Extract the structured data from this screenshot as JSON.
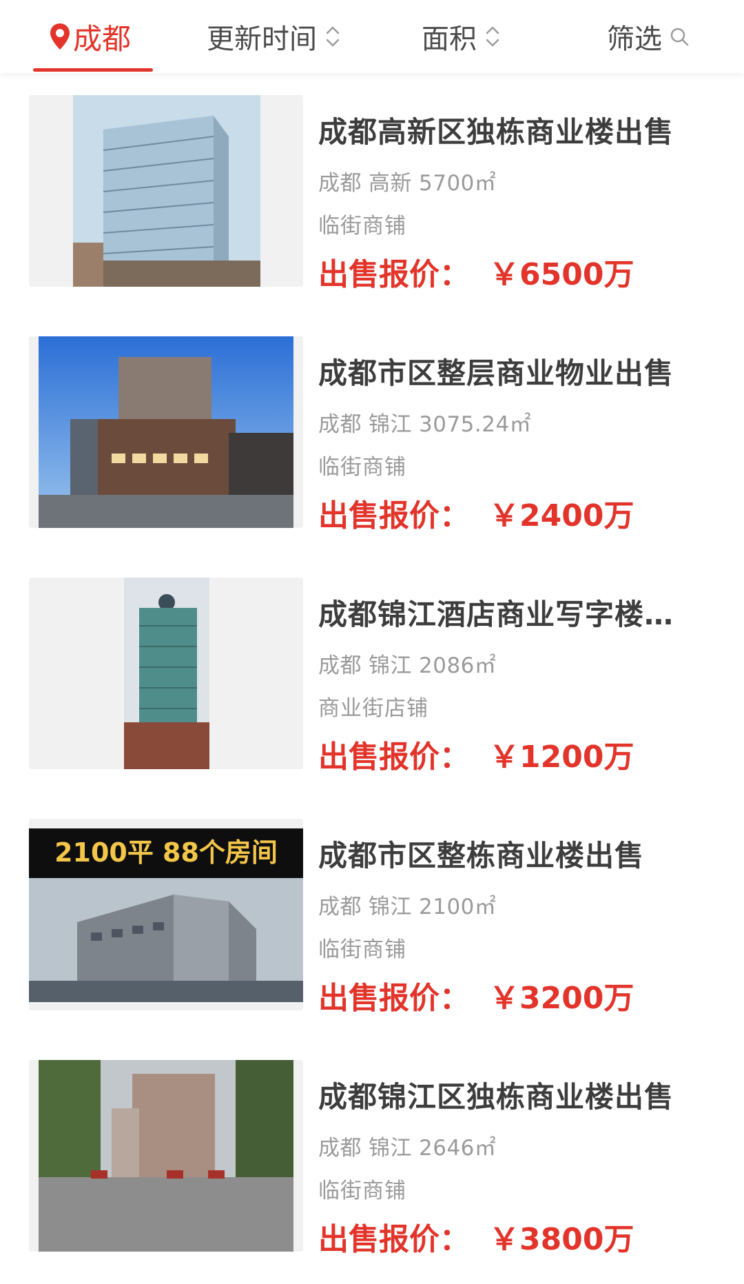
{
  "filter_bar": {
    "city": "成都",
    "update_time": "更新时间",
    "area": "面积",
    "filter": "筛选",
    "accent_color": "#e2342a"
  },
  "listings": [
    {
      "title": "成都高新区独栋商业楼出售",
      "city": "成都",
      "district": "高新",
      "area": "5700㎡",
      "type": "临街商铺",
      "price_label": "出售报价：",
      "price": "￥6500万"
    },
    {
      "title": "成都市区整层商业物业出售",
      "city": "成都",
      "district": "锦江",
      "area": "3075.24㎡",
      "type": "临街商铺",
      "price_label": "出售报价：",
      "price": "￥2400万"
    },
    {
      "title": "成都锦江酒店商业写字楼出售",
      "city": "成都",
      "district": "锦江",
      "area": "2086㎡",
      "type": "商业街店铺",
      "price_label": "出售报价：",
      "price": "￥1200万"
    },
    {
      "title": "成都市区整栋商业楼出售",
      "city": "成都",
      "district": "锦江",
      "area": "2100㎡",
      "type": "临街商铺",
      "price_label": "出售报价：",
      "price": "￥3200万",
      "image_caption": "2100平 88个房间"
    },
    {
      "title": "成都锦江区独栋商业楼出售",
      "city": "成都",
      "district": "锦江",
      "area": "2646㎡",
      "type": "临街商铺",
      "price_label": "出售报价：",
      "price": "￥3800万"
    }
  ]
}
